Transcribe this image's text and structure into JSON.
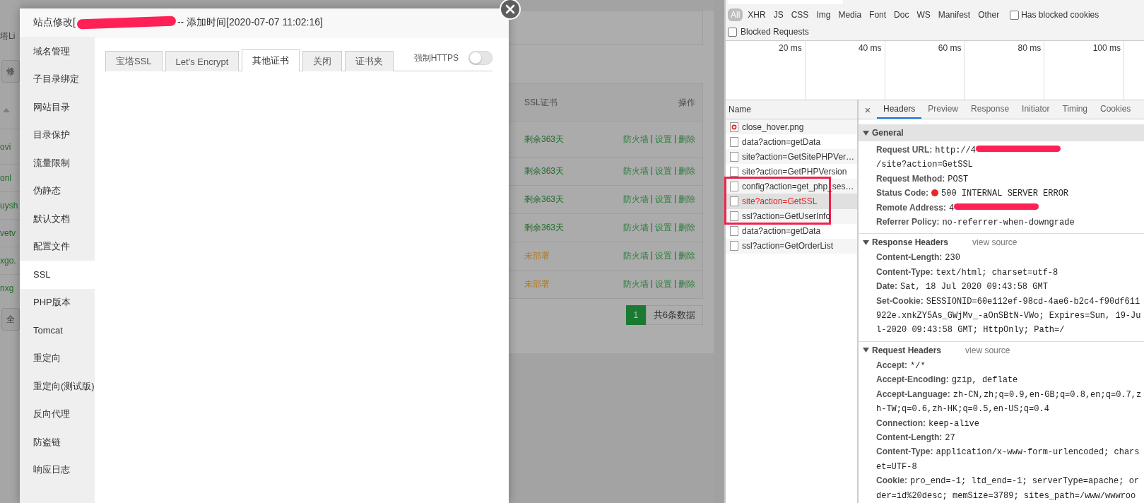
{
  "background_page": {
    "breadcrumb": "塔Li",
    "toolbar_button": "修",
    "table": {
      "columns": [
        "SSL证书",
        "操作"
      ],
      "rows": [
        {
          "name": "ovi",
          "ssl": "剩余363天",
          "color": "#1f6a2a",
          "actions": [
            "防火墙",
            "|",
            "设置",
            "|",
            "删除"
          ]
        },
        {
          "name": "onl",
          "ssl": "剩余363天",
          "color": "#1f6a2a",
          "actions": [
            "防火墙",
            "|",
            "设置",
            "|",
            "删除"
          ]
        },
        {
          "name": "uysh",
          "ssl": "剩余363天",
          "color": "#1f6a2a",
          "actions": [
            "防火墙",
            "|",
            "设置",
            "|",
            "删除"
          ]
        },
        {
          "name": "vetv",
          "ssl": "剩余363天",
          "color": "#1f6a2a",
          "actions": [
            "防火墙",
            "|",
            "设置",
            "|",
            "删除"
          ]
        },
        {
          "name": "xgo.",
          "ssl": "未部署",
          "color": "#b27a1c",
          "actions": [
            "防火墙",
            "|",
            "设置",
            "|",
            "删除"
          ]
        },
        {
          "name": "nxg",
          "ssl": "未部署",
          "color": "#b27a1c",
          "actions": [
            "防火墙",
            "|",
            "设置",
            "|",
            "删除"
          ]
        }
      ]
    },
    "select_all_button": "全",
    "pagination": {
      "pages": [
        {
          "label": "1",
          "selected": true
        }
      ],
      "total": "共6条数据"
    }
  },
  "modal": {
    "title_prefix": "站点修改[",
    "title_redacted": true,
    "title_suffix": "-- 添加时间[2020-07-07 11:02:16]",
    "sidebar": [
      {
        "label": "域名管理",
        "selected": false
      },
      {
        "label": "子目录绑定",
        "selected": false
      },
      {
        "label": "网站目录",
        "selected": false
      },
      {
        "label": "目录保护",
        "selected": false
      },
      {
        "label": "流量限制",
        "selected": false
      },
      {
        "label": "伪静态",
        "selected": false
      },
      {
        "label": "默认文档",
        "selected": false
      },
      {
        "label": "配置文件",
        "selected": false
      },
      {
        "label": "SSL",
        "selected": true
      },
      {
        "label": "PHP版本",
        "selected": false
      },
      {
        "label": "Tomcat",
        "selected": false
      },
      {
        "label": "重定向",
        "selected": false
      },
      {
        "label": "重定向(测试版)",
        "selected": false
      },
      {
        "label": "反向代理",
        "selected": false
      },
      {
        "label": "防盗链",
        "selected": false
      },
      {
        "label": "响应日志",
        "selected": false
      }
    ],
    "tabs": [
      {
        "label": "宝塔SSL",
        "selected": false
      },
      {
        "label": "Let's Encrypt",
        "selected": false
      },
      {
        "label": "其他证书",
        "selected": true
      },
      {
        "label": "关闭",
        "selected": false
      },
      {
        "label": "证书夹",
        "selected": false
      }
    ],
    "force_https": {
      "label": "强制HTTPS",
      "on": false
    }
  },
  "devtools": {
    "type_filters": [
      {
        "label": "All",
        "selected": true
      },
      {
        "label": "XHR",
        "selected": false
      },
      {
        "label": "JS",
        "selected": false
      },
      {
        "label": "CSS",
        "selected": false
      },
      {
        "label": "Img",
        "selected": false
      },
      {
        "label": "Media",
        "selected": false
      },
      {
        "label": "Font",
        "selected": false
      },
      {
        "label": "Doc",
        "selected": false
      },
      {
        "label": "WS",
        "selected": false
      },
      {
        "label": "Manifest",
        "selected": false
      },
      {
        "label": "Other",
        "selected": false
      }
    ],
    "has_blocked_cookies": {
      "label": "Has blocked cookies",
      "checked": false
    },
    "blocked_requests": {
      "label": "Blocked Requests",
      "checked": false
    },
    "timeline_ticks": [
      "20 ms",
      "40 ms",
      "60 ms",
      "80 ms",
      "100 ms"
    ],
    "name_column": "Name",
    "requests": [
      {
        "name": "close_hover.png",
        "kind": "image",
        "selected": false,
        "failed": false
      },
      {
        "name": "data?action=getData",
        "kind": "doc",
        "selected": false,
        "failed": false
      },
      {
        "name": "site?action=GetSitePHPVer…",
        "kind": "doc",
        "selected": false,
        "failed": false
      },
      {
        "name": "site?action=GetPHPVersion",
        "kind": "doc",
        "selected": false,
        "failed": false
      },
      {
        "name": "config?action=get_php_ses…",
        "kind": "doc",
        "selected": false,
        "failed": false
      },
      {
        "name": "site?action=GetSSL",
        "kind": "doc",
        "selected": true,
        "failed": true
      },
      {
        "name": "ssl?action=GetUserInfo",
        "kind": "doc",
        "selected": false,
        "failed": false
      },
      {
        "name": "data?action=getData",
        "kind": "doc",
        "selected": false,
        "failed": false
      },
      {
        "name": "ssl?action=GetOrderList",
        "kind": "doc",
        "selected": false,
        "failed": false
      }
    ],
    "detail_close": "×",
    "detail_tabs": [
      {
        "label": "Headers",
        "selected": true
      },
      {
        "label": "Preview",
        "selected": false
      },
      {
        "label": "Response",
        "selected": false
      },
      {
        "label": "Initiator",
        "selected": false
      },
      {
        "label": "Timing",
        "selected": false
      },
      {
        "label": "Cookies",
        "selected": false
      }
    ],
    "sections": [
      {
        "title": "General",
        "expanded": true,
        "rows": [
          {
            "key": "Request URL:",
            "value": "http://4",
            "redacted": true,
            "value_after": "/site?action=GetSSL"
          },
          {
            "key": "Request Method:",
            "value": "POST"
          },
          {
            "key": "Status Code:",
            "value": "500 INTERNAL SERVER ERROR",
            "color": "#e8262b"
          },
          {
            "key": "Remote Address:",
            "value": "4",
            "redacted": true
          },
          {
            "key": "Referrer Policy:",
            "value": "no-referrer-when-downgrade"
          }
        ]
      },
      {
        "title": "Response Headers",
        "expanded": true,
        "link": "view source",
        "rows": [
          {
            "key": "Content-Length:",
            "value": "230"
          },
          {
            "key": "Content-Type:",
            "value": "text/html; charset=utf-8"
          },
          {
            "key": "Date:",
            "value": "Sat, 18 Jul 2020 09:43:58 GMT"
          },
          {
            "key": "Set-Cookie:",
            "value": "SESSIONID=60e112ef-98cd-4ae6-b2c4-f90df611922e.xnkZY5As_GWjMv_-aOnSBtN-VWo; Expires=Sun, 19-Jul-2020 09:43:58 GMT; HttpOnly; Path=/"
          }
        ]
      },
      {
        "title": "Request Headers",
        "expanded": true,
        "link": "view source",
        "rows": [
          {
            "key": "Accept:",
            "value": "*/*"
          },
          {
            "key": "Accept-Encoding:",
            "value": "gzip, deflate"
          },
          {
            "key": "Accept-Language:",
            "value": "zh-CN,zh;q=0.9,en-GB;q=0.8,en;q=0.7,zh-TW;q=0.6,zh-HK;q=0.5,en-US;q=0.4"
          },
          {
            "key": "Connection:",
            "value": "keep-alive"
          },
          {
            "key": "Content-Length:",
            "value": "27"
          },
          {
            "key": "Content-Type:",
            "value": "application/x-www-form-urlencoded; charset=UTF-8"
          },
          {
            "key": "Cookie:",
            "value": "pro_end=-1; ltd_end=-1; serverType=apache; order=id%20desc; memSize=3789; sites_path=/www/wwwroo"
          }
        ]
      }
    ]
  }
}
